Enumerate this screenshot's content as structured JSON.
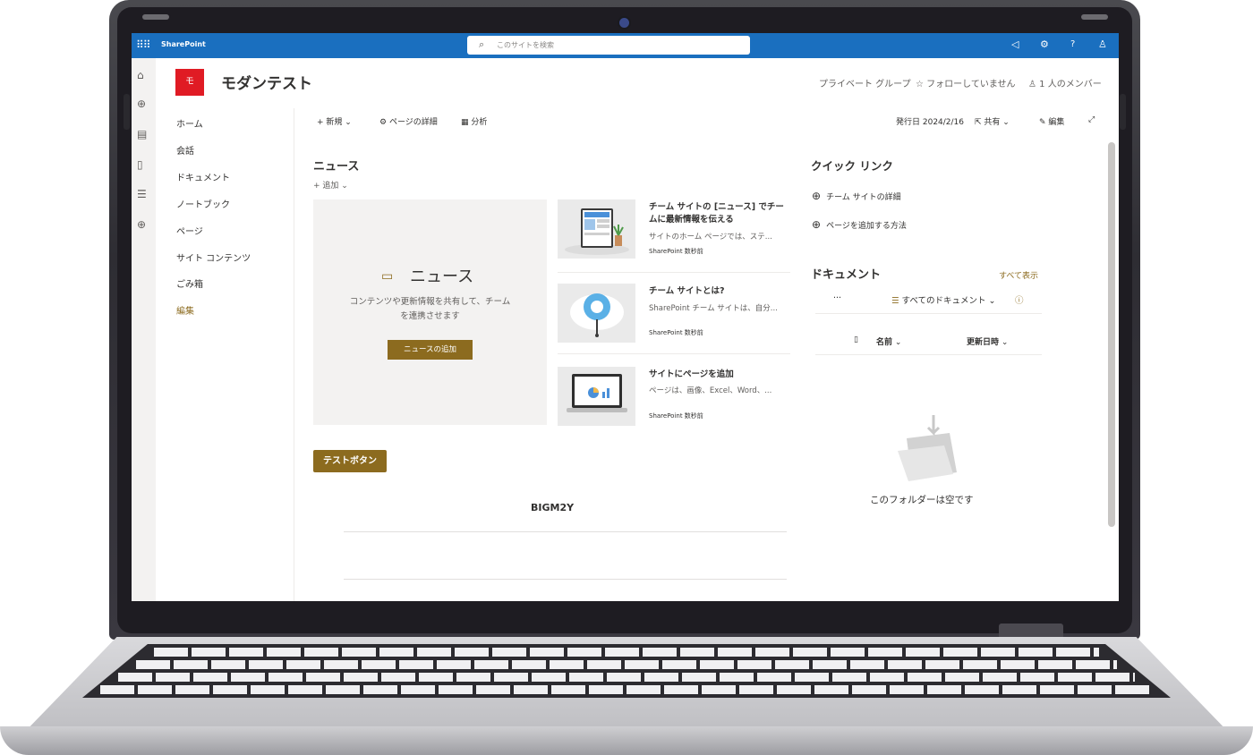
{
  "suitebar": {
    "brand": "SharePoint",
    "search_placeholder": "このサイトを検索",
    "icons": [
      "waffle-icon",
      "megaphone-icon",
      "settings-icon",
      "help-icon",
      "account-icon"
    ],
    "help_glyph": "?"
  },
  "site": {
    "logo_letter": "モ",
    "title": "モダンテスト",
    "group_type": "プライベート グループ",
    "follow": "フォローしていません",
    "members": "1 人のメンバー",
    "logo_color": "#e01b24"
  },
  "nav": {
    "items": [
      "ホーム",
      "会話",
      "ドキュメント",
      "ノートブック",
      "ページ",
      "サイト コンテンツ",
      "ごみ箱",
      "編集"
    ]
  },
  "cmdbar": {
    "new": "新規",
    "page_details": "ページの詳細",
    "analytics": "分析",
    "published": "発行日 2024/2/16",
    "share": "共有",
    "edit": "編集"
  },
  "news": {
    "heading": "ニュース",
    "add": "追加",
    "empty_title": "ニュース",
    "empty_desc": "コンテンツや更新情報を共有して、チームを連携させます",
    "add_button": "ニュースの追加",
    "items": [
      {
        "title": "チーム サイトの [ニュース] でチームに最新情報を伝える",
        "desc": "サイトのホーム ページでは、ステ...",
        "source": "SharePoint 数秒前"
      },
      {
        "title": "チーム サイトとは?",
        "desc": "SharePoint チーム サイトは、自分...",
        "source": "SharePoint 数秒前"
      },
      {
        "title": "サイトにページを追加",
        "desc": "ページは、画像、Excel、Word、...",
        "source": "SharePoint 数秒前"
      }
    ]
  },
  "test_button": "テストボタン",
  "text_block": "BIGM2Y",
  "quick_links": {
    "heading": "クイック リンク",
    "items": [
      "チーム サイトの詳細",
      "ページを追加する方法"
    ]
  },
  "documents": {
    "heading": "ドキュメント",
    "see_all": "すべて表示",
    "more": "···",
    "view": "すべてのドキュメント",
    "info": "ⓘ",
    "col_name": "名前",
    "col_modified": "更新日時",
    "empty": "このフォルダーは空です"
  },
  "colors": {
    "suitebar": "#1a6fbf",
    "accent": "#8c6b1f"
  }
}
